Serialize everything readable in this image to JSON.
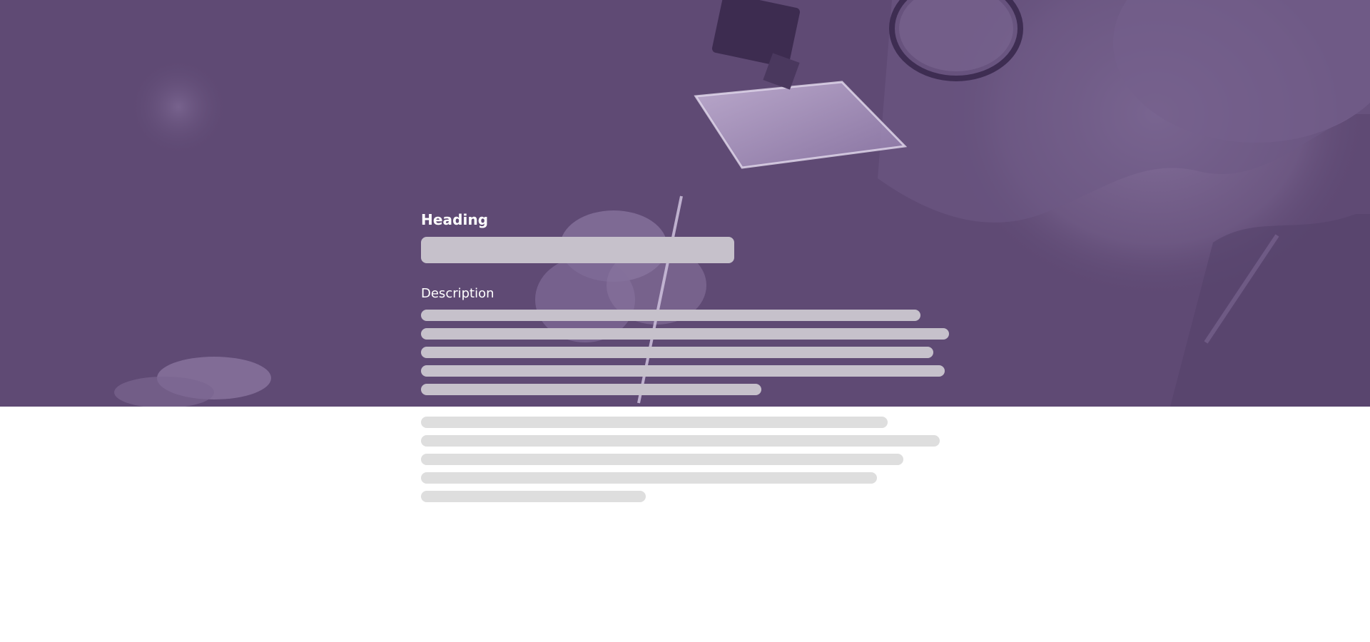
{
  "hero": {
    "image": "craftsman-with-magnifying-glasses-photo",
    "overlay_color": "#5f4a74"
  },
  "form": {
    "heading_label": "Heading",
    "description_label": "Description"
  },
  "colors": {
    "placeholder_on_image": "#c6c1cb",
    "placeholder_on_white": "#dedede",
    "text_on_image": "#ffffff"
  }
}
